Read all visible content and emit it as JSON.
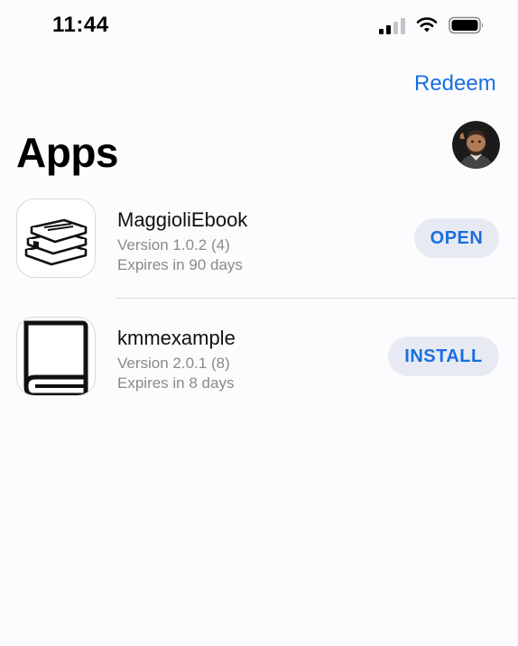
{
  "status_bar": {
    "time": "11:44"
  },
  "header": {
    "redeem_label": "Redeem",
    "title": "Apps"
  },
  "apps": [
    {
      "name": "MaggioliEbook",
      "version": "Version 1.0.2 (4)",
      "expires": "Expires in 90 days",
      "action": "OPEN",
      "icon": "books-stack-icon"
    },
    {
      "name": "kmmexample",
      "version": "Version 2.0.1 (8)",
      "expires": "Expires in 8 days",
      "action": "INSTALL",
      "icon": "book-icon"
    }
  ],
  "colors": {
    "accent": "#1a6fe0",
    "button_bg": "#e8eaf3",
    "secondary_text": "#8a8a8e"
  }
}
